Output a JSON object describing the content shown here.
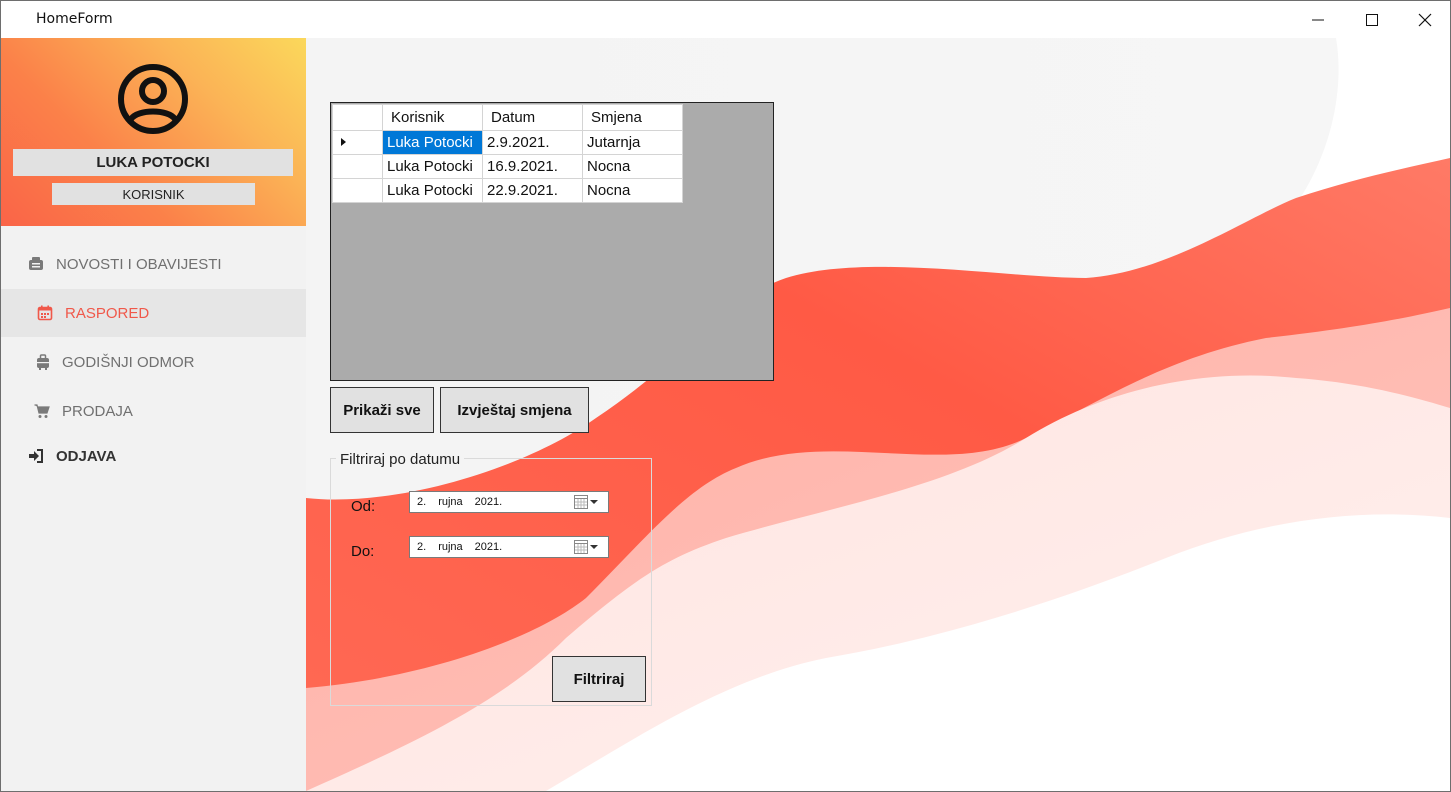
{
  "window": {
    "title": "HomeForm"
  },
  "sidebar": {
    "username": "LUKA POTOCKI",
    "role": "KORISNIK",
    "items": [
      {
        "label": "NOVOSTI I OBAVIJESTI",
        "icon": "news-icon"
      },
      {
        "label": "RASPORED",
        "icon": "calendar-icon",
        "active": true
      },
      {
        "label": "GODIŠNJI ODMOR",
        "icon": "suitcase-icon"
      },
      {
        "label": "PRODAJA",
        "icon": "cart-icon"
      },
      {
        "label": "ODJAVA",
        "icon": "logout-icon"
      }
    ]
  },
  "grid": {
    "columns": [
      "Korisnik",
      "Datum",
      "Smjena"
    ],
    "rows": [
      [
        "Luka Potocki",
        "2.9.2021.",
        "Jutarnja"
      ],
      [
        "Luka Potocki",
        "16.9.2021.",
        "Nocna"
      ],
      [
        "Luka Potocki",
        "22.9.2021.",
        "Nocna"
      ]
    ]
  },
  "buttons": {
    "show_all": "Prikaži sve",
    "shift_report": "Izvještaj smjena",
    "filter": "Filtriraj"
  },
  "filter": {
    "legend": "Filtriraj po datumu",
    "from_label": "Od:",
    "to_label": "Do:",
    "from": {
      "day": "2.",
      "month": "rujna",
      "year": "2021."
    },
    "to": {
      "day": "2.",
      "month": "rujna",
      "year": "2021."
    }
  },
  "colors": {
    "accent": "#f0584a",
    "selection": "#0078d7"
  }
}
